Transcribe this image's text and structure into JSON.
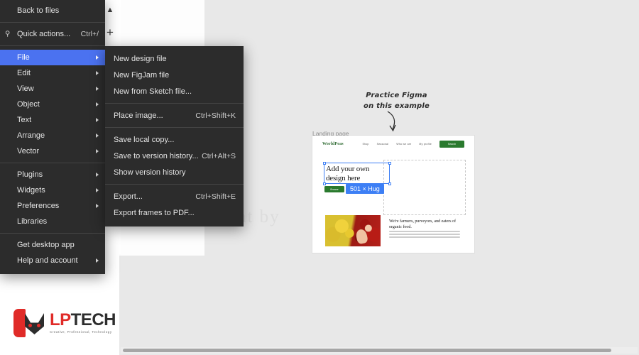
{
  "app": {
    "name": "Figma",
    "window_title": "Figma main menu"
  },
  "toolbar": {
    "chevron_up_icon": "chevron-up-icon",
    "plus_icon": "plus-icon"
  },
  "main_menu": {
    "groups": [
      {
        "items": [
          {
            "label": "Back to files",
            "shortcut": "",
            "submenu": false,
            "icon": ""
          }
        ]
      },
      {
        "items": [
          {
            "label": "Quick actions...",
            "shortcut": "Ctrl+/",
            "submenu": false,
            "icon": "search-icon"
          }
        ]
      },
      {
        "items": [
          {
            "label": "File",
            "shortcut": "",
            "submenu": true,
            "selected": true
          },
          {
            "label": "Edit",
            "shortcut": "",
            "submenu": true
          },
          {
            "label": "View",
            "shortcut": "",
            "submenu": true
          },
          {
            "label": "Object",
            "shortcut": "",
            "submenu": true
          },
          {
            "label": "Text",
            "shortcut": "",
            "submenu": true
          },
          {
            "label": "Arrange",
            "shortcut": "",
            "submenu": true
          },
          {
            "label": "Vector",
            "shortcut": "",
            "submenu": true
          }
        ]
      },
      {
        "items": [
          {
            "label": "Plugins",
            "shortcut": "",
            "submenu": true
          },
          {
            "label": "Widgets",
            "shortcut": "",
            "submenu": true
          },
          {
            "label": "Preferences",
            "shortcut": "",
            "submenu": true
          },
          {
            "label": "Libraries",
            "shortcut": "",
            "submenu": false
          }
        ]
      },
      {
        "items": [
          {
            "label": "Get desktop app",
            "shortcut": "",
            "submenu": false
          },
          {
            "label": "Help and account",
            "shortcut": "",
            "submenu": true
          }
        ]
      }
    ]
  },
  "file_submenu": {
    "groups": [
      {
        "items": [
          {
            "label": "New design file",
            "shortcut": ""
          },
          {
            "label": "New FigJam file",
            "shortcut": ""
          },
          {
            "label": "New from Sketch file...",
            "shortcut": ""
          }
        ]
      },
      {
        "items": [
          {
            "label": "Place image...",
            "shortcut": "Ctrl+Shift+K"
          }
        ]
      },
      {
        "items": [
          {
            "label": "Save local copy...",
            "shortcut": ""
          },
          {
            "label": "Save to version history...",
            "shortcut": "Ctrl+Alt+S"
          },
          {
            "label": "Show version history",
            "shortcut": ""
          }
        ]
      },
      {
        "items": [
          {
            "label": "Export...",
            "shortcut": "Ctrl+Shift+E"
          },
          {
            "label": "Export frames to PDF...",
            "shortcut": ""
          }
        ]
      }
    ]
  },
  "canvas": {
    "annotation_line1": "Practice Figma",
    "annotation_line2": "on this example",
    "arrow_icon": "curved-arrow-down-icon",
    "frame_label": "Landing page",
    "ghost_text": "Copyright by"
  },
  "mockup": {
    "logo": "WorldPeas",
    "nav_links": [
      "Shop",
      "Seasonal",
      "Who we are",
      "My profile"
    ],
    "cta_label": "Search",
    "heading": "Add your own design here",
    "button_label": "Browse",
    "size_badge": "501 × Hug",
    "subheading": "We're farmers, purveyors, and eaters of organic food.",
    "photo_alt": "peppers-photo"
  },
  "brand": {
    "name_part1": "LP",
    "name_part2": "TECH",
    "tagline": "Creative, Professional, Technology"
  },
  "watermark": {
    "text_left": "LP",
    "text_right": "TECH"
  },
  "scrollbar": {
    "orientation": "horizontal"
  },
  "colors": {
    "menu_bg": "#2c2c2c",
    "menu_selected": "#4b72f0",
    "canvas_bg": "#e8e8e8",
    "brand_red": "#e02b28",
    "mockup_green": "#2a7a2e",
    "selection_blue": "#3d7ff5"
  }
}
